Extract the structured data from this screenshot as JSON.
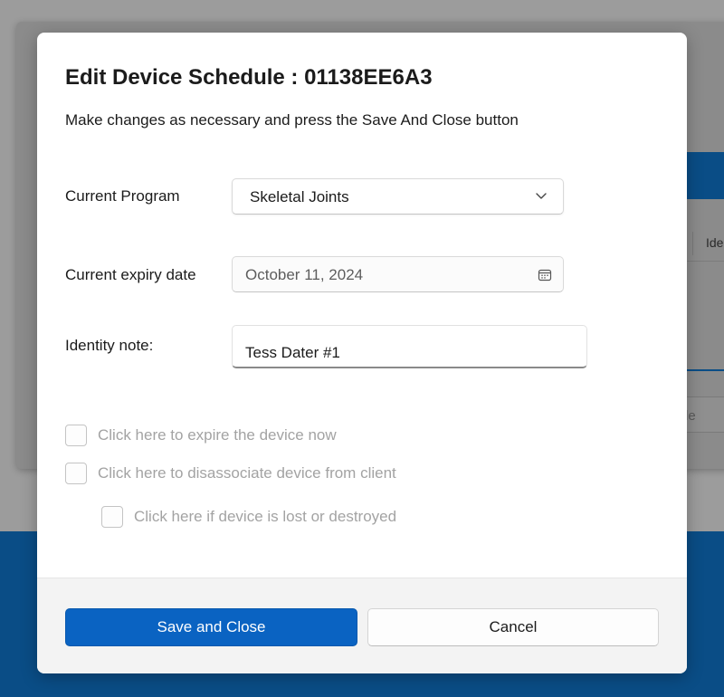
{
  "background": {
    "tab_label": "Ide",
    "button_label": "le"
  },
  "dialog": {
    "title": "Edit Device Schedule : 01138EE6A3",
    "subtitle": "Make changes as necessary and press the Save And Close button",
    "program": {
      "label": "Current Program",
      "value": "Skeletal Joints",
      "icon": "chevron-down-icon"
    },
    "expiry": {
      "label": "Current expiry date",
      "value": "October 11, 2024",
      "icon": "calendar-icon"
    },
    "identity": {
      "label": "Identity note:",
      "value": "Tess Dater #1"
    },
    "checkboxes": [
      {
        "label": "Click here to expire the device now",
        "checked": false,
        "disabled": true
      },
      {
        "label": "Click here to disassociate device from client",
        "checked": false,
        "disabled": true
      },
      {
        "label": "Click here if device is lost or destroyed",
        "checked": false,
        "disabled": true
      }
    ],
    "buttons": {
      "save": "Save and Close",
      "cancel": "Cancel"
    }
  },
  "colors": {
    "primary": "#0a63c2",
    "background_accent": "#0a4d86",
    "disabled_text": "#a3a3a3"
  }
}
